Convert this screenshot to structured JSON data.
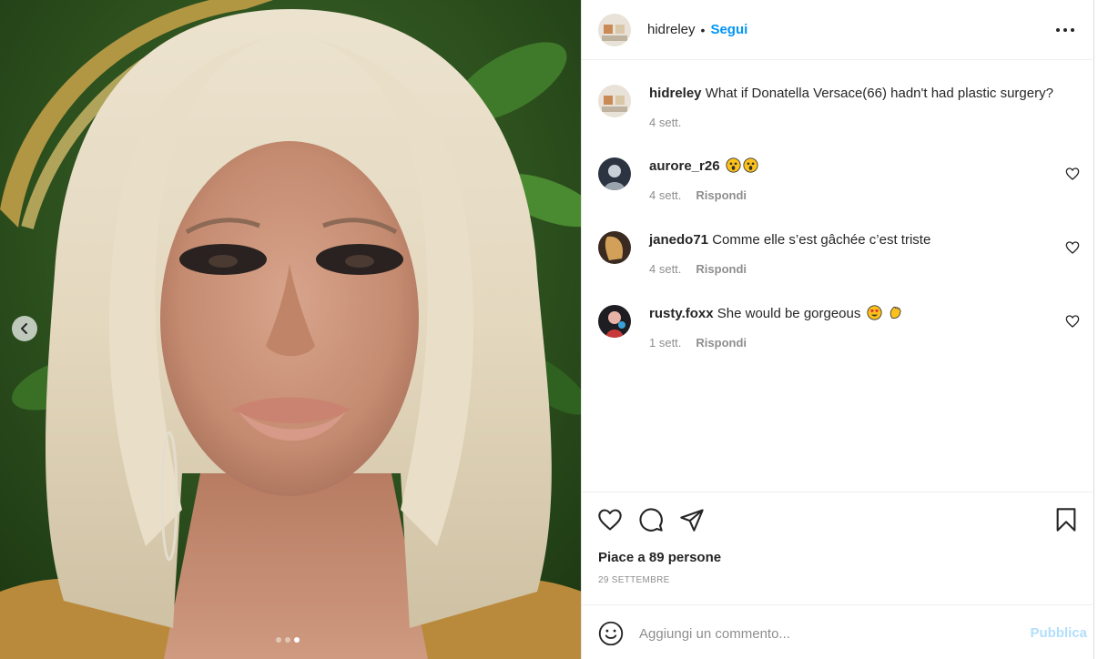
{
  "post": {
    "author": "hidreley",
    "separator": "•",
    "follow_label": "Segui",
    "more_icon": "more-horizontal-icon"
  },
  "media": {
    "carousel_dots": 3,
    "active_dot": 3,
    "prev_icon": "chevron-left-icon"
  },
  "caption": {
    "user": "hidreley",
    "text": "What if Donatella Versace(66) hadn't had plastic surgery?",
    "time": "4 sett."
  },
  "comments": [
    {
      "user": "aurore_r26",
      "text": "",
      "emoji": [
        "astonished-emoji",
        "astonished-emoji"
      ],
      "time": "4 sett.",
      "reply": "Rispondi"
    },
    {
      "user": "janedo71",
      "text": "Comme elle s’est gâchée c’est triste",
      "emoji": [],
      "time": "4 sett.",
      "reply": "Rispondi"
    },
    {
      "user": "rusty.foxx",
      "text": "She would be gorgeous",
      "emoji": [
        "heart-eyes-emoji",
        "clapping-hands-emoji"
      ],
      "time": "1 sett.",
      "reply": "Rispondi"
    }
  ],
  "actions": {
    "likes_prefix": "Piace a ",
    "likes_count": "89",
    "likes_suffix": " persone",
    "date": "29 SETTEMBRE"
  },
  "add_comment": {
    "placeholder": "Aggiungi un commento...",
    "publish_label": "Pubblica"
  },
  "colors": {
    "link_blue": "#0095f6",
    "publish_disabled": "#b2dffc",
    "muted": "#8e8e8e"
  }
}
